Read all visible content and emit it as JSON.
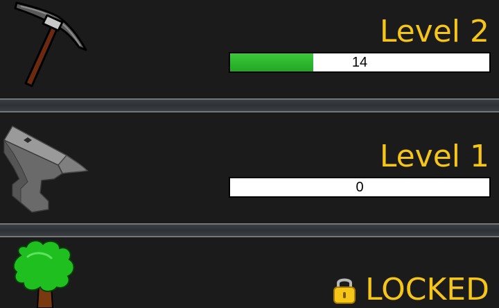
{
  "colors": {
    "background": "#1b1b1b",
    "level_text": "#f5c518",
    "xp_fill": "#2db52d",
    "xp_track": "#ffffff"
  },
  "skills": [
    {
      "icon": "pickaxe-icon",
      "level_label": "Level 2",
      "xp_value": "14",
      "xp_progress_percent": 32
    },
    {
      "icon": "anvil-icon",
      "level_label": "Level 1",
      "xp_value": "0",
      "xp_progress_percent": 0
    },
    {
      "icon": "tree-icon",
      "status_icon": "padlock-icon",
      "status_label": "LOCKED"
    }
  ]
}
